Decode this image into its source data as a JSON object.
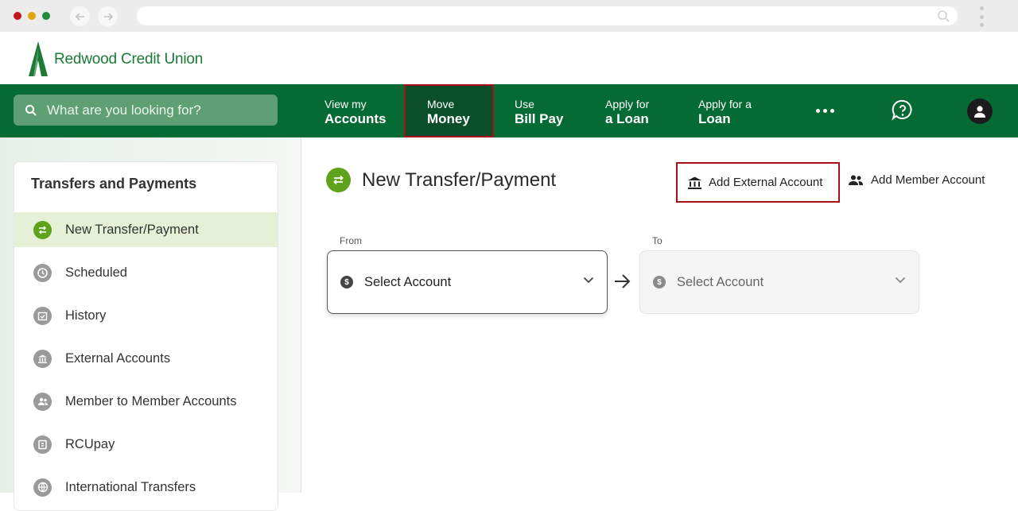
{
  "browser": {
    "back_icon": "back-arrow-icon",
    "forward_icon": "forward-arrow-icon",
    "url_text": ""
  },
  "brand": {
    "name": "Redwood Credit Union",
    "logo_color": "#1a7a36"
  },
  "topnav": {
    "background": "#066a35",
    "search_placeholder": "What are you looking for?",
    "items": [
      {
        "line1": "View my",
        "line2": "Accounts"
      },
      {
        "line1": "Move",
        "line2": "Money",
        "active": true
      },
      {
        "line1": "Use",
        "line2": "Bill Pay"
      },
      {
        "line1": "Apply for",
        "line2": "a Loan"
      },
      {
        "line1": "Apply for a",
        "line2": "Loan"
      }
    ],
    "more_icon": "more-dots-icon",
    "help_icon": "chat-help-icon",
    "profile_icon": "user-avatar-icon"
  },
  "sidebar": {
    "title": "Transfers and Payments",
    "items": [
      {
        "label": "New Transfer/Payment",
        "icon": "transfer-icon",
        "active": true
      },
      {
        "label": "Scheduled",
        "icon": "clock-icon"
      },
      {
        "label": "History",
        "icon": "calendar-check-icon"
      },
      {
        "label": "External Accounts",
        "icon": "bank-icon"
      },
      {
        "label": "Member to Member Accounts",
        "icon": "people-icon"
      },
      {
        "label": "RCUpay",
        "icon": "rcupay-icon"
      },
      {
        "label": "International Transfers",
        "icon": "globe-icon"
      }
    ]
  },
  "main": {
    "title": "New Transfer/Payment",
    "add_external_label": "Add External Account",
    "add_member_label": "Add Member Account",
    "from_label": "From",
    "to_label": "To",
    "from_value": "Select Account",
    "to_value": "Select Account"
  },
  "colors": {
    "accent_green": "#5fa31c",
    "highlight_red": "#a6111a"
  }
}
